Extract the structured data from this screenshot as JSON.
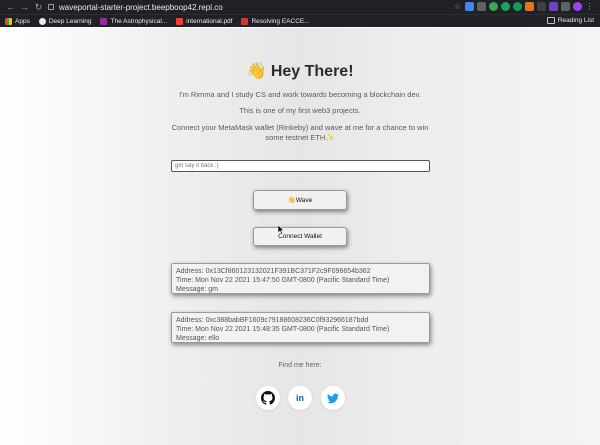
{
  "browser": {
    "url": "waveportal-starter-project.beepboop42.repl.co",
    "bookmarks": [
      "Apps",
      "Deep Learning",
      "The Astrophysical...",
      "international.pdf",
      "Resolving EACCE..."
    ],
    "reading_list": "Reading List"
  },
  "page": {
    "title": "👋 Hey There!",
    "intro": "I'm Rimma and I study CS and work towards becoming a blockchain dev.",
    "project_note": "This is one of my first web3 projects.",
    "cta_line1": "Connect your MetaMask wallet (Rinkeby) and wave at me for a chance to win",
    "cta_line2": "some testnet ETH✨",
    "input_placeholder": "gm say it back :)",
    "wave_button": "👋Wave",
    "connect_button": "Connect Wallet",
    "waves": [
      {
        "address": "Address: 0x13Cf860123132021F391BC371F2c9F096654b362",
        "time": "Time: Mon Nov 22 2021 15:47:50 GMT-0800 (Pacific Standard Time)",
        "message": "Message: gm"
      },
      {
        "address": "Address: 0xc388babBF1609c79188608236C0f932966187bdd",
        "time": "Time: Mon Nov 22 2021 15:48:35 GMT-0800 (Pacific Standard Time)",
        "message": "Message: ello"
      }
    ],
    "find_me": "Find me here:",
    "social_icons": [
      "github-icon",
      "linkedin-icon",
      "twitter-icon"
    ]
  },
  "colors": {
    "linkedin": "#0a66c2",
    "twitter": "#1d9bf0",
    "github": "#111111"
  }
}
